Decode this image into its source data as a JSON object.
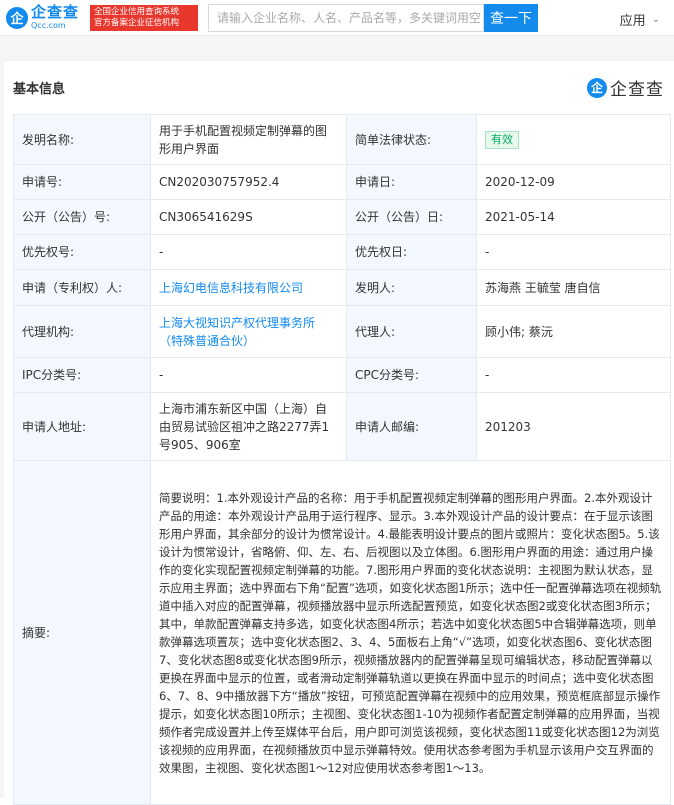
{
  "header": {
    "logo_mark": "企",
    "logo_cn": "企查查",
    "logo_en": "Qcc.com",
    "badge_line1": "全国企业信用查询系统",
    "badge_line2": "官方备案企业征信机构",
    "search_placeholder": "请输入企业名称、人名、产品名等，多关键词用空",
    "search_button": "查一下",
    "app_menu": "应用",
    "chevron": "⌄"
  },
  "card": {
    "title": "基本信息",
    "brand_mark": "企",
    "brand_text": "企查查"
  },
  "table": {
    "design_name_label": "发明名称:",
    "design_name": "用于手机配置视频定制弹幕的图形用户界面",
    "legal_status_label": "简单法律状态:",
    "legal_status": "有效",
    "app_no_label": "申请号:",
    "app_no": "CN202030757952.4",
    "app_date_label": "申请日:",
    "app_date": "2020-12-09",
    "pub_no_label": "公开（公告）号:",
    "pub_no": "CN306541629S",
    "pub_date_label": "公开（公告）日:",
    "pub_date": "2021-05-14",
    "priority_no_label": "优先权号:",
    "priority_no": "-",
    "priority_date_label": "优先权日:",
    "priority_date": "-",
    "applicant_label": "申请（专利权）人:",
    "applicant": "上海幻电信息科技有限公司",
    "inventor_label": "发明人:",
    "inventor": "苏海燕 王毓莹 唐自信",
    "agency_label": "代理机构:",
    "agency": "上海大视知识产权代理事务所（特殊普通合伙）",
    "agent_label": "代理人:",
    "agent": "顾小伟; 蔡沅",
    "ipc_label": "IPC分类号:",
    "ipc": "-",
    "cpc_label": "CPC分类号:",
    "cpc": "-",
    "address_label": "申请人地址:",
    "address": "上海市浦东新区中国（上海）自由贸易试验区祖冲之路2277弄1号905、906室",
    "postcode_label": "申请人邮编:",
    "postcode": "201203",
    "abstract_label": "摘要:",
    "abstract": "简要说明：1.本外观设计产品的名称：用于手机配置视频定制弹幕的图形用户界面。2.本外观设计产品的用途：本外观设计产品用于运行程序、显示。3.本外观设计产品的设计要点：在于显示该图形用户界面，其余部分的设计为惯常设计。4.最能表明设计要点的图片或照片：变化状态图5。5.该设计为惯常设计，省略俯、仰、左、右、后视图以及立体图。6.图形用户界面的用途：通过用户操作的变化实现配置视频定制弹幕的功能。7.图形用户界面的变化状态说明：主视图为默认状态，显示应用主界面；选中界面右下角“配置”选项，如变化状态图1所示；选中任一配置弹幕选项在视频轨道中插入对应的配置弹幕，视频播放器中显示所选配置预览，如变化状态图2或变化状态图3所示；其中，单款配置弹幕支持多选，如变化状态图4所示；若选中如变化状态图5中合辑弹幕选项，则单款弹幕选项置灰；选中变化状态图2、3、4、5面板右上角“√”选项，如变化状态图6、变化状态图7、变化状态图8或变化状态图9所示，视频播放器内的配置弹幕呈现可编辑状态，移动配置弹幕以更换在界面中显示的位置，或者滑动定制弹幕轨道以更换在界面中显示的时间点；选中变化状态图6、7、8、9中播放器下方“播放”按钮，可预览配置弹幕在视频中的应用效果，预览框底部显示操作提示，如变化状态图10所示；主视图、变化状态图1-10为视频作者配置定制弹幕的应用界面，当视频作者完成设置并上传至媒体平台后，用户即可浏览该视频，变化状态图11或变化状态图12为浏览该视频的应用界面，在视频播放页中显示弹幕特效。使用状态参考图为手机显示该用户交互界面的效果图，主视图、变化状态图1～12对应使用状态参考图1～13。"
  }
}
